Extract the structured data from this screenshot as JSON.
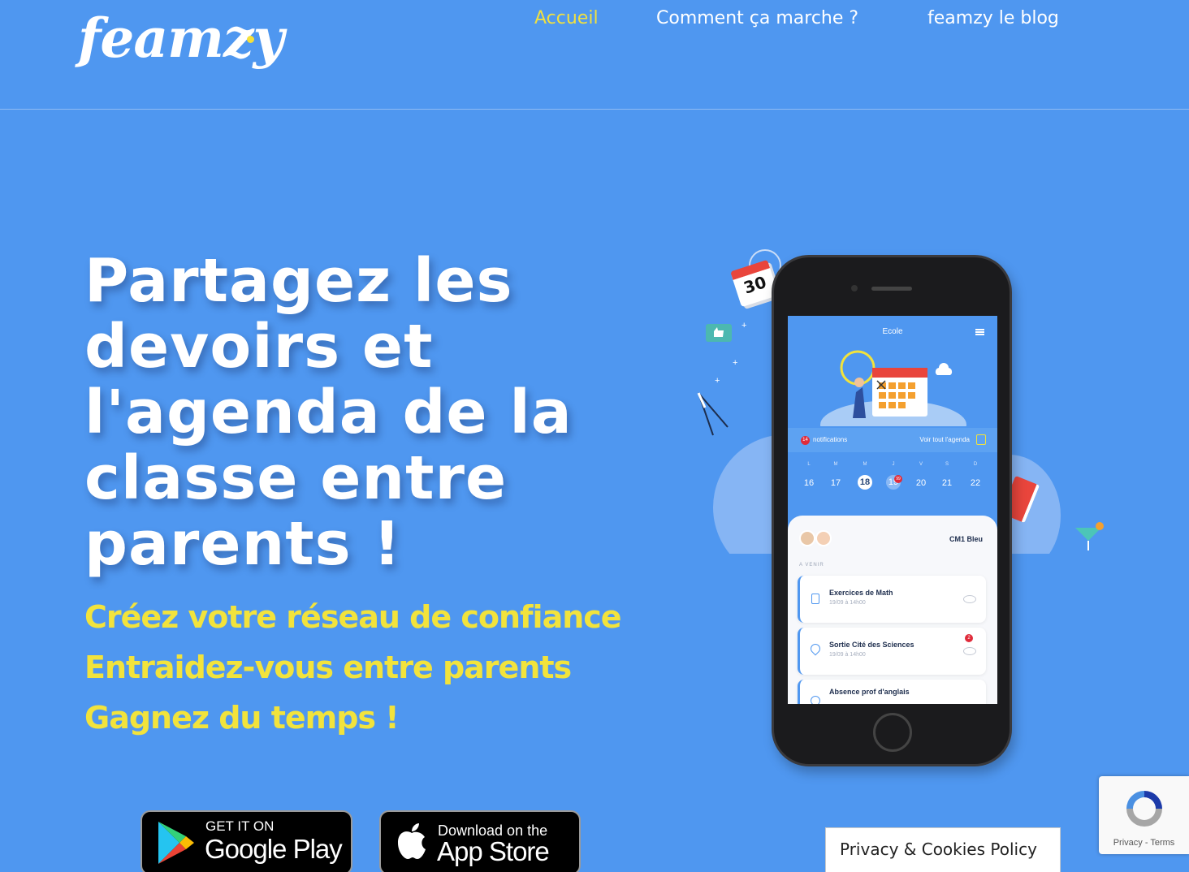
{
  "brand": {
    "logo_text": "feamzy"
  },
  "nav": {
    "items": [
      {
        "label": "Accueil",
        "active": true
      },
      {
        "label": "Comment ça marche ?",
        "active": false
      },
      {
        "label": "feamzy le blog",
        "active": false
      }
    ]
  },
  "hero": {
    "headline": "Partagez les devoirs et l'agenda de la classe entre parents !",
    "taglines": [
      "Créez votre réseau de confiance",
      "Entraidez-vous entre parents",
      "Gagnez du temps !"
    ]
  },
  "stores": {
    "google": {
      "small": "GET IT ON",
      "big": "Google Play"
    },
    "apple": {
      "small": "Download on the",
      "big": "App Store"
    }
  },
  "phone_screen": {
    "title": "Ecole",
    "notifications_count": "14",
    "notifications_label": "notifications",
    "agenda_link": "Voir tout l'agenda",
    "day_letters": [
      "L",
      "M",
      "M",
      "J",
      "V",
      "S",
      "D"
    ],
    "day_numbers": [
      "16",
      "17",
      "18",
      "19",
      "20",
      "21",
      "22"
    ],
    "selected_day": "18",
    "day_badge": "99",
    "class_name": "CM1 Bleu",
    "section_label": "A VENIR",
    "tasks": [
      {
        "title": "Exercices de Math",
        "sub": "19/09 à 14h00",
        "icon": "document-icon"
      },
      {
        "title": "Sortie Cité des Sciences",
        "sub": "19/09 à 14h00",
        "icon": "location-pin-icon",
        "badge": "2"
      },
      {
        "title": "Absence prof d'anglais",
        "sub": "",
        "icon": "location-pin-icon"
      }
    ]
  },
  "decorations": {
    "calendar_day": "30"
  },
  "recaptcha": {
    "text": "Privacy - Terms"
  },
  "cookie": {
    "label": "Privacy & Cookies Policy"
  },
  "colors": {
    "background": "#4f97f0",
    "accent_yellow": "#f2e33c",
    "nav_active": "#f0e040"
  }
}
